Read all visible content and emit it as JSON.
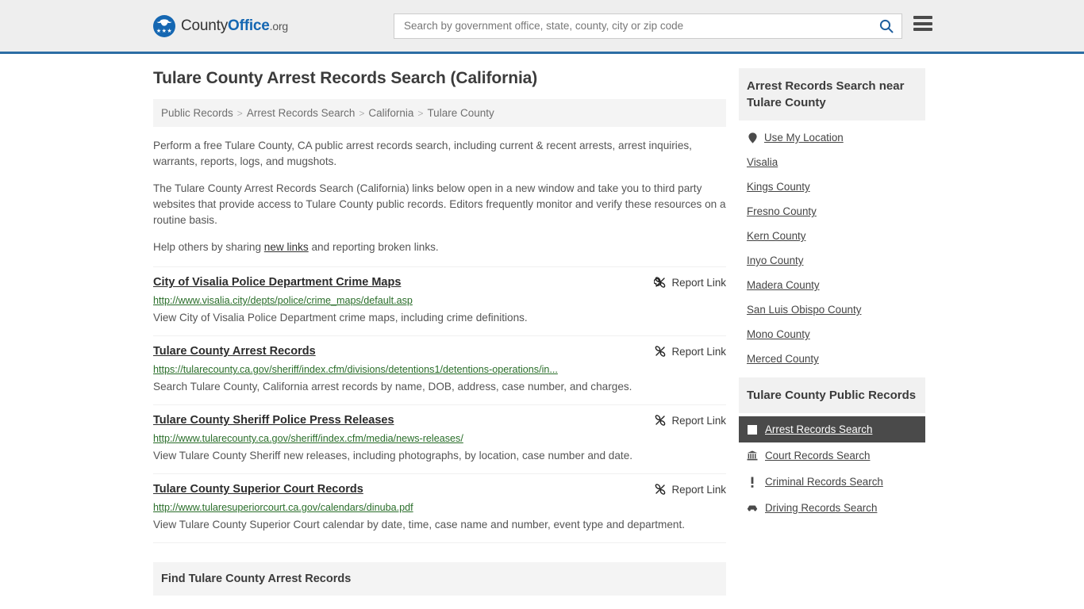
{
  "header": {
    "brand": {
      "part1": "County",
      "part2": "Office",
      "part3": ".org",
      "logo_icon": "eagle-shield-logo",
      "stars": "★★★"
    },
    "search": {
      "placeholder": "Search by government office, state, county, city or zip code",
      "value": "",
      "icon": "search-icon"
    },
    "menu_icon": "hamburger-menu-icon"
  },
  "main": {
    "title": "Tulare County Arrest Records Search (California)",
    "breadcrumb": [
      {
        "label": "Public Records"
      },
      {
        "label": "Arrest Records Search"
      },
      {
        "label": "California"
      },
      {
        "label": "Tulare County"
      }
    ],
    "breadcrumb_separator": ">",
    "intro": [
      "Perform a free Tulare County, CA public arrest records search, including current & recent arrests, arrest inquiries, warrants, reports, logs, and mugshots.",
      "The Tulare County Arrest Records Search (California) links below open in a new window and take you to third party websites that provide access to Tulare County public records. Editors frequently monitor and verify these resources on a routine basis."
    ],
    "help_prefix": "Help others by sharing ",
    "help_link": "new links",
    "help_suffix": " and reporting broken links.",
    "report_link_label": "Report Link",
    "report_link_icon": "broken-link-icon",
    "results": [
      {
        "title": "City of Visalia Police Department Crime Maps",
        "url": "http://www.visalia.city/depts/police/crime_maps/default.asp",
        "description": "View City of Visalia Police Department crime maps, including crime definitions."
      },
      {
        "title": "Tulare County Arrest Records",
        "url": "https://tularecounty.ca.gov/sheriff/index.cfm/divisions/detentions1/detentions-operations/in...",
        "description": "Search Tulare County, California arrest records by name, DOB, address, case number, and charges."
      },
      {
        "title": "Tulare County Sheriff Police Press Releases",
        "url": "http://www.tularecounty.ca.gov/sheriff/index.cfm/media/news-releases/",
        "description": "View Tulare County Sheriff new releases, including photographs, by location, case number and date."
      },
      {
        "title": "Tulare County Superior Court Records",
        "url": "http://www.tularesuperiorcourt.ca.gov/calendars/dinuba.pdf",
        "description": "View Tulare County Superior Court calendar by date, time, case name and number, event type and department."
      }
    ],
    "find_section_title": "Find Tulare County Arrest Records"
  },
  "sidebar": {
    "nearby": {
      "header": "Arrest Records Search near Tulare County",
      "items": [
        {
          "label": "Use My Location",
          "icon": "map-pin-icon"
        },
        {
          "label": "Visalia",
          "icon": ""
        },
        {
          "label": "Kings County",
          "icon": ""
        },
        {
          "label": "Fresno County",
          "icon": ""
        },
        {
          "label": "Kern County",
          "icon": ""
        },
        {
          "label": "Inyo County",
          "icon": ""
        },
        {
          "label": "Madera County",
          "icon": ""
        },
        {
          "label": "San Luis Obispo County",
          "icon": ""
        },
        {
          "label": "Mono County",
          "icon": ""
        },
        {
          "label": "Merced County",
          "icon": ""
        }
      ]
    },
    "public_records": {
      "header": "Tulare County Public Records",
      "items": [
        {
          "label": "Arrest Records Search",
          "icon": "white-square-icon",
          "active": true
        },
        {
          "label": "Court Records Search",
          "icon": "courthouse-icon",
          "active": false
        },
        {
          "label": "Criminal Records Search",
          "icon": "exclamation-icon",
          "active": false
        },
        {
          "label": "Driving Records Search",
          "icon": "car-icon",
          "active": false
        }
      ]
    }
  },
  "colors": {
    "brand_blue": "#1567b2",
    "header_border": "#2c6da4",
    "url_green": "#2a6e2a",
    "active_bg": "#4a4a4a",
    "panel_gray": "#f1f1f1"
  }
}
